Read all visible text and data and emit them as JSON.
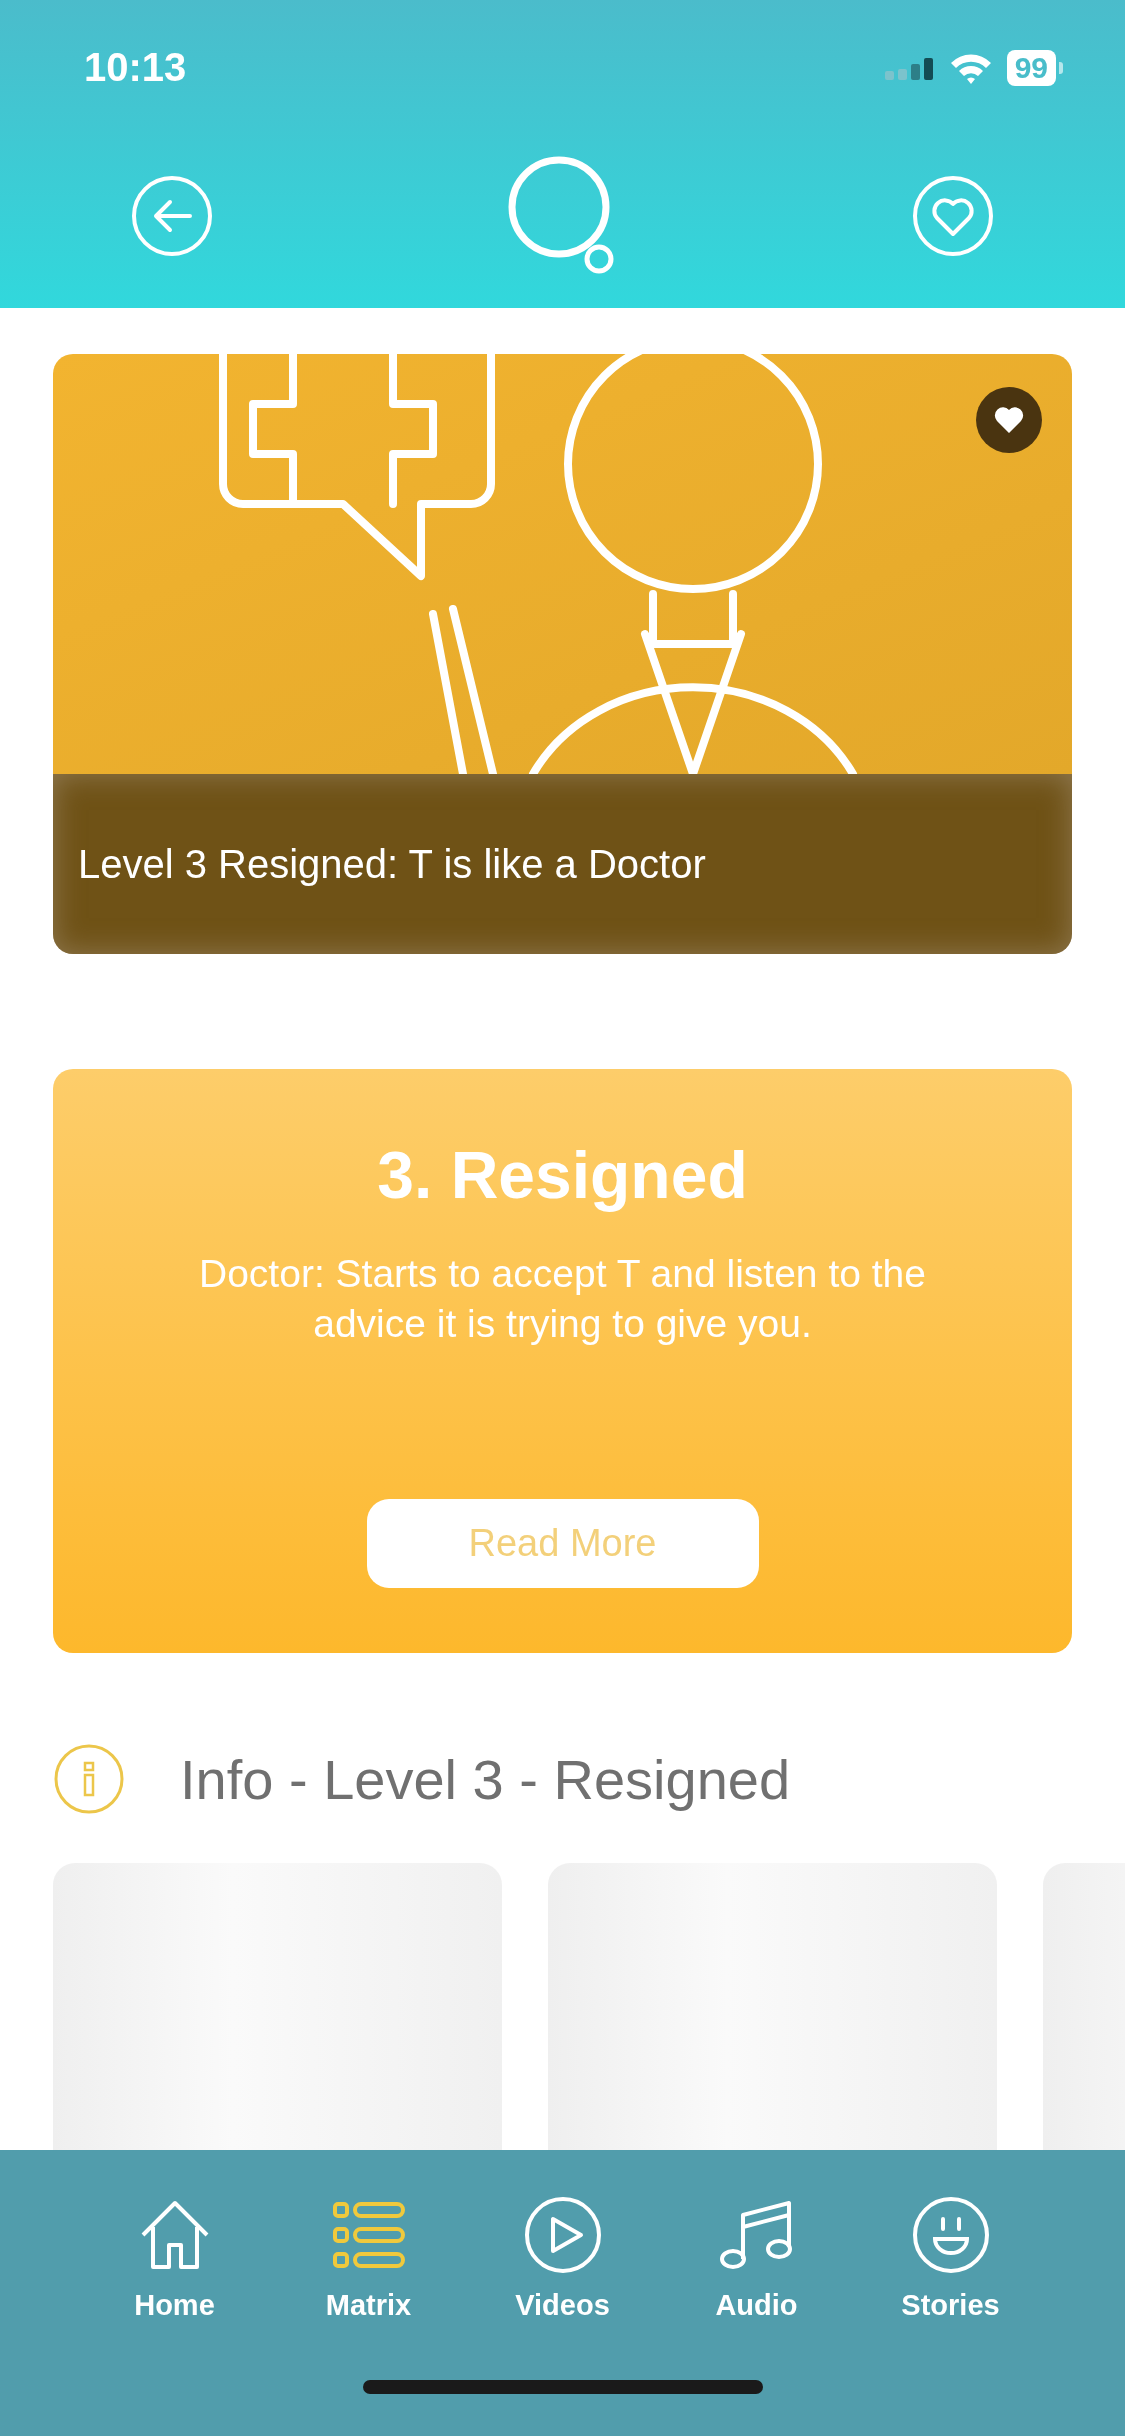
{
  "status_bar": {
    "time": "10:13",
    "battery": "99"
  },
  "hero_card": {
    "caption": "Level 3 Resigned: T is like a Doctor"
  },
  "level_card": {
    "title": "3. Resigned",
    "description": "Doctor: Starts to accept T and listen to the advice it is trying to give you.",
    "button": "Read More"
  },
  "info_section": {
    "heading": "Info - Level 3 - Resigned"
  },
  "bottom_nav": [
    {
      "label": "Home",
      "kind": "home",
      "selected": false
    },
    {
      "label": "Matrix",
      "kind": "list",
      "selected": true
    },
    {
      "label": "Videos",
      "kind": "play",
      "selected": false
    },
    {
      "label": "Audio",
      "kind": "music",
      "selected": false
    },
    {
      "label": "Stories",
      "kind": "smile",
      "selected": false
    }
  ]
}
